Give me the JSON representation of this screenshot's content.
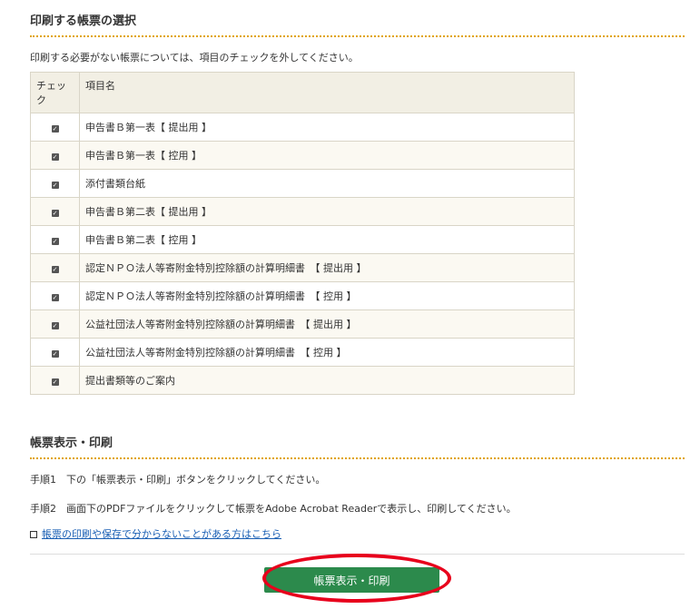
{
  "selection": {
    "title": "印刷する帳票の選択",
    "note": "印刷する必要がない帳票については、項目のチェックを外してください。",
    "col_check_line1": "チェッ",
    "col_check_line2": "ク",
    "col_name": "項目名",
    "rows": [
      {
        "checked": true,
        "name": "申告書Ｂ第一表【 提出用 】"
      },
      {
        "checked": true,
        "name": "申告書Ｂ第一表【 控用 】"
      },
      {
        "checked": true,
        "name": "添付書類台紙"
      },
      {
        "checked": true,
        "name": "申告書Ｂ第二表【 提出用 】"
      },
      {
        "checked": true,
        "name": "申告書Ｂ第二表【 控用 】"
      },
      {
        "checked": true,
        "name": "認定ＮＰＯ法人等寄附金特別控除額の計算明細書　【 提出用 】"
      },
      {
        "checked": true,
        "name": "認定ＮＰＯ法人等寄附金特別控除額の計算明細書　【 控用 】"
      },
      {
        "checked": true,
        "name": "公益社団法人等寄附金特別控除額の計算明細書　【 提出用 】"
      },
      {
        "checked": true,
        "name": "公益社団法人等寄附金特別控除額の計算明細書　【 控用 】"
      },
      {
        "checked": true,
        "name": "提出書類等のご案内"
      }
    ]
  },
  "print": {
    "title": "帳票表示・印刷",
    "step1": "手順1　下の「帳票表示・印刷」ボタンをクリックしてください。",
    "step2": "手順2　画面下のPDFファイルをクリックして帳票をAdobe Acrobat Readerで表示し、印刷してください。",
    "help_link": "帳票の印刷や保存で分からないことがある方はこちら",
    "button_label": "帳票表示・印刷"
  },
  "colors": {
    "accent_dotted": "#e0a400",
    "button_green": "#2c8a4c",
    "highlight_ring": "#e8001c",
    "link": "#1a5fb4"
  }
}
